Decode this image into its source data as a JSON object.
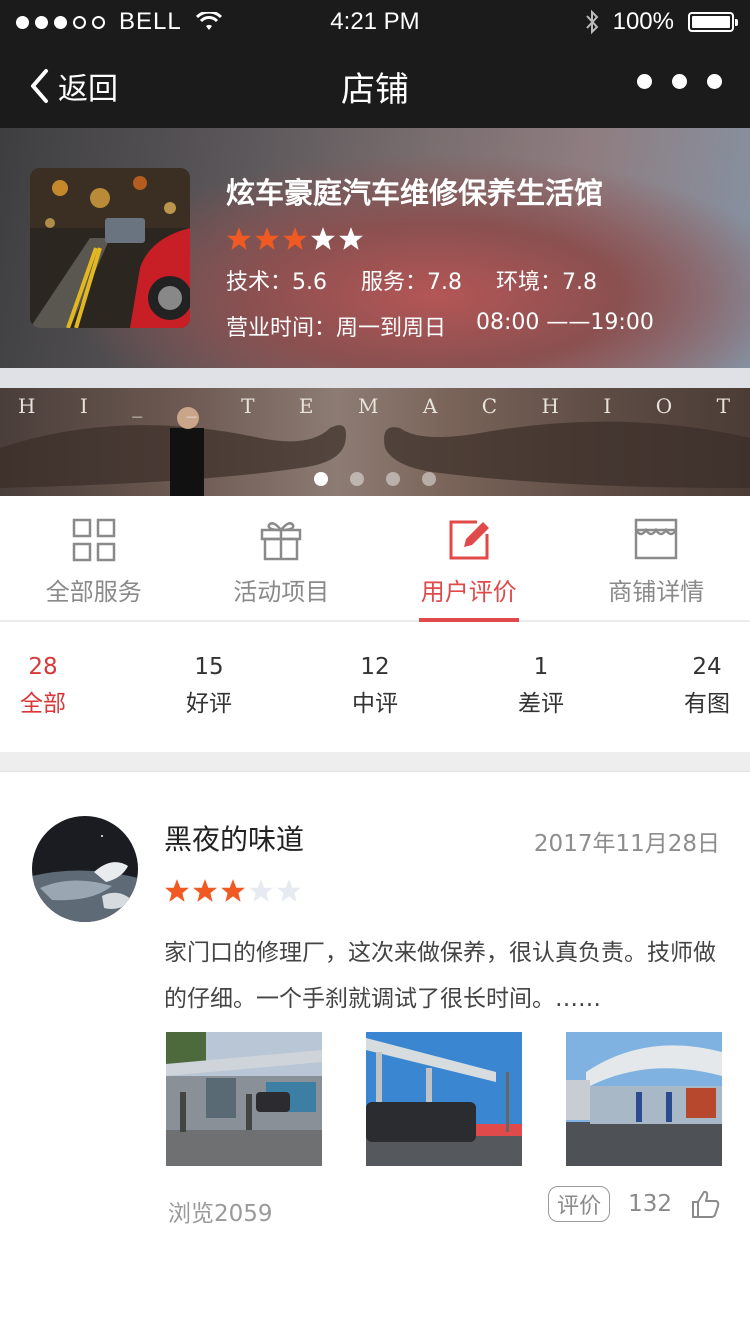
{
  "status_bar": {
    "carrier": "BELL",
    "time": "4:21 PM",
    "battery": "100%"
  },
  "nav": {
    "back_label": "返回",
    "title": "店铺"
  },
  "store": {
    "name": "炫车豪庭汽车维修保养生活馆",
    "rating": 3,
    "rating_max": 5,
    "scores": [
      "技术：5.6",
      "服务：7.8",
      "环境：7.8"
    ],
    "hours_label": "营业时间：周一到周日",
    "hours_value": "08:00 ——19:00"
  },
  "banner": {
    "letters": [
      "H",
      "I",
      "_",
      "_",
      "T",
      "E",
      "M",
      "A",
      "C",
      "H",
      "I",
      "O",
      "T"
    ],
    "slide_count": 4,
    "active_slide": 0
  },
  "tabs": [
    {
      "label": "全部服务",
      "icon": "grid-icon",
      "active": false
    },
    {
      "label": "活动项目",
      "icon": "gift-icon",
      "active": false
    },
    {
      "label": "用户评价",
      "icon": "edit-icon",
      "active": true
    },
    {
      "label": "商铺详情",
      "icon": "store-icon",
      "active": false
    }
  ],
  "filters": [
    {
      "count": "28",
      "label": "全部",
      "active": true
    },
    {
      "count": "15",
      "label": "好评",
      "active": false
    },
    {
      "count": "12",
      "label": "中评",
      "active": false
    },
    {
      "count": "1",
      "label": "差评",
      "active": false
    },
    {
      "count": "24",
      "label": "有图",
      "active": false
    }
  ],
  "review": {
    "user": "黑夜的味道",
    "date": "2017年11月28日",
    "rating": 3,
    "text": "家门口的修理厂，这次来做保养，很认真负责。技师做的仔细。一个手刹就调试了很长时间。……",
    "views": "浏览2059",
    "rate_button": "评价",
    "likes": "132"
  },
  "colors": {
    "accent": "#e04a4a",
    "star_on": "#f05a22",
    "star_off_header": "#ffffff",
    "star_off_review": "#e6ebf1"
  }
}
